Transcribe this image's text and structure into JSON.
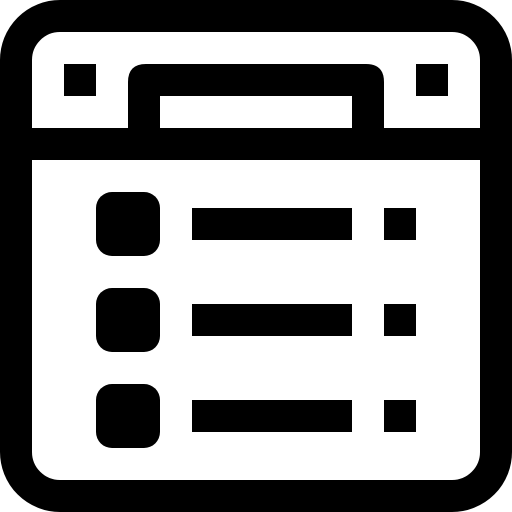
{
  "icon": {
    "name": "browser-window-list-icon",
    "stroke_color": "#000000",
    "fill_color": "#ffffff"
  },
  "list": {
    "rows": [
      {
        "bullet": "rounded-square",
        "line": "text-line",
        "marker": "small-square"
      },
      {
        "bullet": "rounded-square",
        "line": "text-line",
        "marker": "small-square"
      },
      {
        "bullet": "rounded-square",
        "line": "text-line",
        "marker": "small-square"
      }
    ]
  }
}
